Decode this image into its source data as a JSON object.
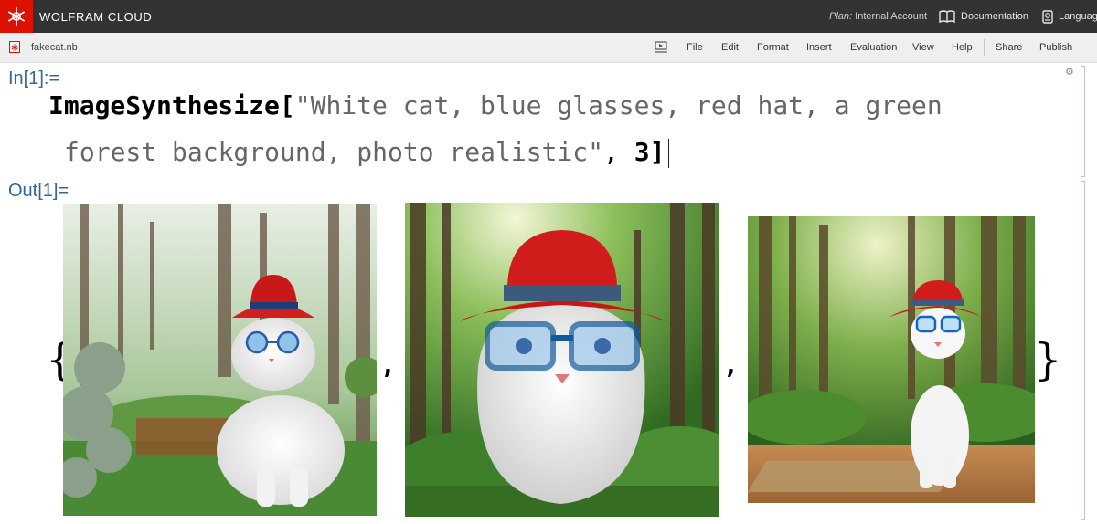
{
  "topbar": {
    "brand": "WOLFRAM CLOUD",
    "plan_label": "Plan:",
    "plan_value": "Internal Account",
    "documentation": "Documentation",
    "language": "Language"
  },
  "toolbar": {
    "filename": "fakecat.nb",
    "menus": [
      "File",
      "Edit",
      "Format",
      "Insert",
      "Evaluation",
      "View",
      "Help"
    ],
    "share": "Share",
    "publish": "Publish"
  },
  "cell": {
    "in_label": "In[1]:=",
    "out_label": "Out[1]=",
    "function": "ImageSynthesize",
    "open_bracket": "[",
    "string_line1": "\"White cat, blue glasses, red hat, a green",
    "string_line2": "forest background, photo realistic\"",
    "arg_sep": ", ",
    "count": "3",
    "close_bracket": "]",
    "open_brace": "{",
    "close_brace": "}",
    "comma": ","
  },
  "images": [
    {
      "alt": "cat with round blue glasses and red hat in misty forest"
    },
    {
      "alt": "fluffy cat with large blue glasses and red hat in green forest"
    },
    {
      "alt": "cat with blue glasses and red hat sitting on wooden floor in forest"
    }
  ],
  "colors": {
    "accent": "#dd1100",
    "topbar": "#333333",
    "label": "#336699"
  }
}
